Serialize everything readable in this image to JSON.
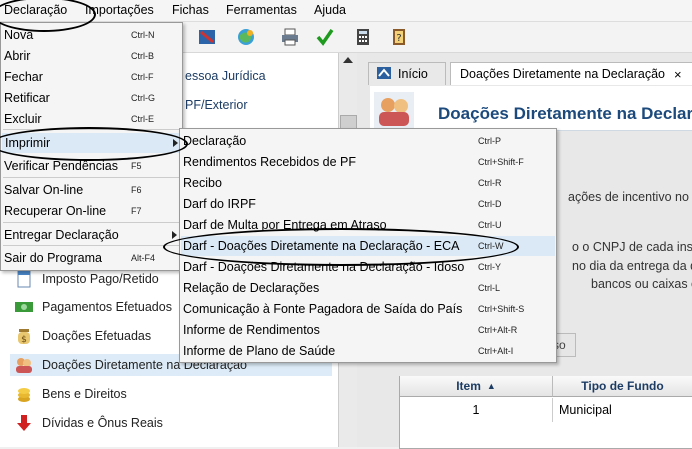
{
  "menubar": [
    "Declaração",
    "Importações",
    "Fichas",
    "Ferramentas",
    "Ajuda"
  ],
  "tabs": {
    "inicio": "Início",
    "doacoes": "Doações Diretamente na Declaração",
    "close": "×"
  },
  "header": {
    "title": "Doações Diretamente na Declar"
  },
  "right_texts": {
    "line1": "ações de incentivo no an",
    "line2": "o o CNPJ de cada instit",
    "line3": "no dia da entrega da dec",
    "line4": "bancos ou caixas ele",
    "subtab": "so"
  },
  "tree_partial": {
    "pj": "essoa Jurídica",
    "pf": "PF/Exterior"
  },
  "tree": [
    "Imposto Pago/Retido",
    "Pagamentos Efetuados",
    "Doações Efetuadas",
    "Doações Diretamente na Declaração",
    "Bens e Direitos",
    "Dívidas e Ônus Reais"
  ],
  "grid": {
    "col_item": "Item",
    "col_sort_glyph": "▲",
    "col_tipo": "Tipo de Fundo",
    "row_item": "1",
    "row_tipo": "Municipal"
  },
  "menu": [
    {
      "label": "Nova",
      "shortcut": "Ctrl-N"
    },
    {
      "label": "Abrir",
      "shortcut": "Ctrl-B"
    },
    {
      "label": "Fechar",
      "shortcut": "Ctrl-F"
    },
    {
      "label": "Retificar",
      "shortcut": "Ctrl-G"
    },
    {
      "label": "Excluir",
      "shortcut": "Ctrl-E"
    },
    {
      "label": "Imprimir",
      "shortcut": ""
    },
    {
      "label": "Verificar Pendências",
      "shortcut": "F5"
    },
    {
      "label": "Salvar On-line",
      "shortcut": "F6"
    },
    {
      "label": "Recuperar On-line",
      "shortcut": "F7"
    },
    {
      "label": "Entregar Declaração",
      "shortcut": ""
    },
    {
      "label": "Sair do Programa",
      "shortcut": "Alt-F4"
    }
  ],
  "submenu": [
    {
      "label": "Declaração",
      "shortcut": "Ctrl-P"
    },
    {
      "label": "Rendimentos Recebidos de PF",
      "shortcut": "Ctrl+Shift-F"
    },
    {
      "label": "Recibo",
      "shortcut": "Ctrl-R"
    },
    {
      "label": "Darf do IRPF",
      "shortcut": "Ctrl-D"
    },
    {
      "label": "Darf de Multa por Entrega em Atraso",
      "shortcut": "Ctrl-U"
    },
    {
      "label": "Darf - Doações Diretamente na Declaração - ECA",
      "shortcut": "Ctrl-W"
    },
    {
      "label": "Darf - Doações Diretamente na Declaração - Idoso",
      "shortcut": "Ctrl-Y"
    },
    {
      "label": "Relação de Declarações",
      "shortcut": "Ctrl-L"
    },
    {
      "label": "Comunicação à Fonte Pagadora de Saída do País",
      "shortcut": "Ctrl+Shift-S"
    },
    {
      "label": "Informe de Rendimentos",
      "shortcut": "Ctrl+Alt-R"
    },
    {
      "label": "Informe de Plano de Saúde",
      "shortcut": "Ctrl+Alt-I"
    }
  ],
  "colors": {
    "accent": "#1c4a7c",
    "highlight": "#dbe9f6",
    "green_check": "#1e9a1e"
  }
}
